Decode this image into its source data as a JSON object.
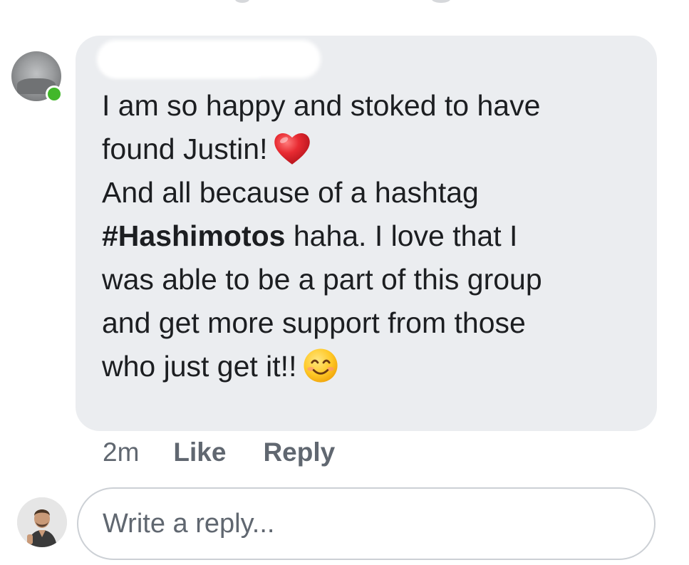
{
  "comment": {
    "line1": "I am so happy and stoked to have",
    "line2": "found Justin!",
    "line3": "And all because of a hashtag",
    "hashtag": "#Hashimotos",
    "line4_rest": " haha. I love that I",
    "line5": "was able to be a part of this group",
    "line6": "and get more support from those",
    "line7": "who just get it!!",
    "heart_emoji": "red-heart",
    "smile_emoji": "smiling-face"
  },
  "actions": {
    "time": "2m",
    "like_label": "Like",
    "reply_label": "Reply"
  },
  "reply": {
    "placeholder": "Write a reply..."
  },
  "colors": {
    "bubble": "#ebedf0",
    "text": "#1c1e21",
    "meta": "#606770",
    "online": "#42b72a",
    "heart": "#e0222b",
    "smile": "#ffcc33"
  }
}
